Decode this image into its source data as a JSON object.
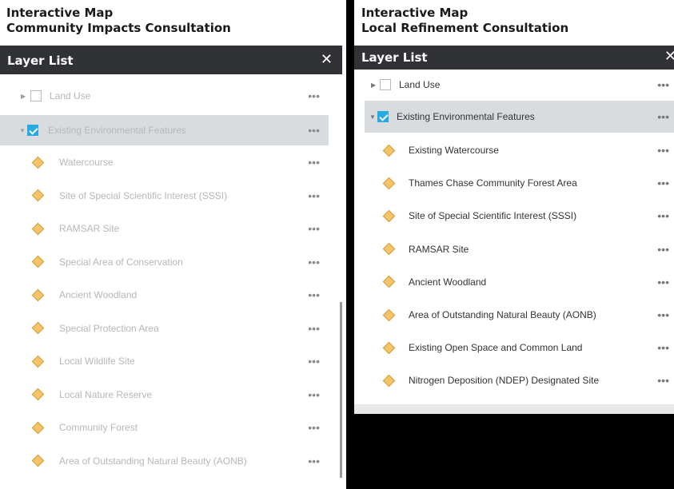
{
  "left": {
    "heading_line1": "Interactive Map",
    "heading_line2": "Community Impacts Consultation",
    "panel_title": "Layer List",
    "close_glyph": "✕",
    "group_land_use": "Land Use",
    "group_env": "Existing Environmental Features",
    "layers": [
      "Watercourse",
      "Site of Special Scientific Interest (SSSI)",
      "RAMSAR Site",
      "Special Area of Conservation",
      "Ancient Woodland",
      "Special Protection Area",
      "Local Wildlife Site",
      "Local Nature Reserve",
      "Community Forest",
      "Area of Outstanding Natural Beauty (AONB)"
    ]
  },
  "right": {
    "heading_line1": "Interactive Map",
    "heading_line2": "Local Refinement Consultation",
    "panel_title": "Layer List",
    "close_glyph": "✕",
    "group_land_use": "Land Use",
    "group_env": "Existing Environmental Features",
    "layers": [
      "Existing Watercourse",
      "Thames Chase Community Forest Area",
      "Site of Special Scientific Interest (SSSI)",
      "RAMSAR Site",
      "Ancient Woodland",
      "Area of Outstanding Natural Beauty (AONB)",
      "Existing Open Space and Common Land",
      "Nitrogen Deposition (NDEP) Designated Site"
    ]
  },
  "menu_glyph": "•••",
  "colors": {
    "titlebar": "#303236",
    "check": "#27a9e1",
    "diamond": "#f4c46b"
  }
}
